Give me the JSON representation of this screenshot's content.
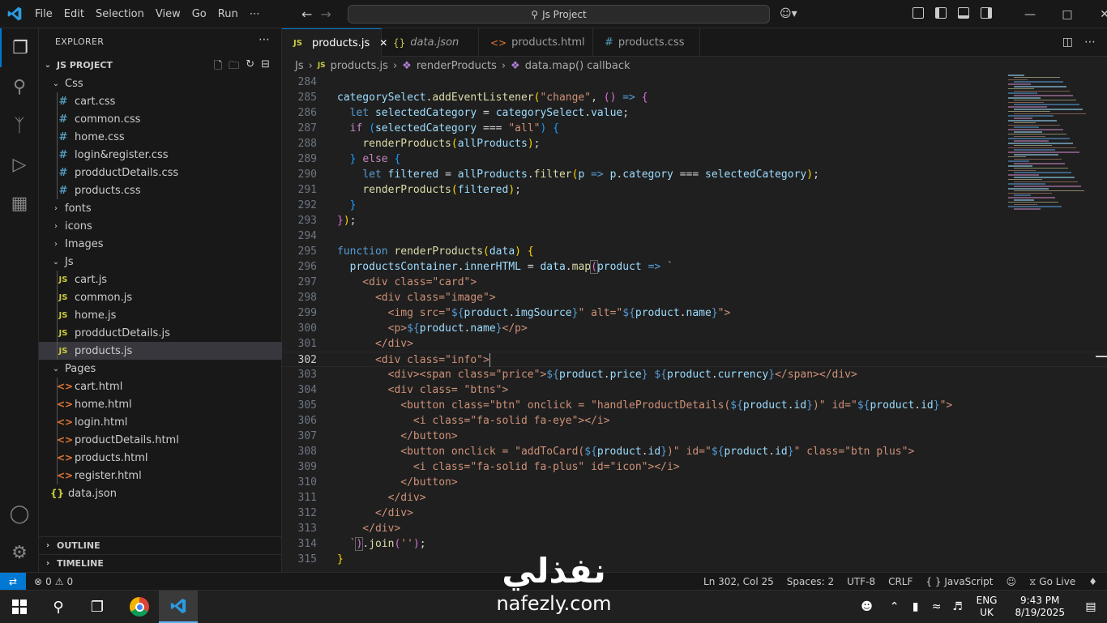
{
  "titlebar": {
    "menu": [
      "File",
      "Edit",
      "Selection",
      "View",
      "Go",
      "Run",
      "⋯"
    ],
    "search": "Js Project"
  },
  "activity": [
    "explorer-icon",
    "search-icon",
    "source-control-icon",
    "run-debug-icon",
    "extensions-icon",
    "accounts-icon",
    "manage-gear-icon"
  ],
  "sidebar": {
    "title": "EXPLORER",
    "project": "JS PROJECT",
    "tree": [
      {
        "label": "Css",
        "type": "folder",
        "open": true,
        "depth": 1
      },
      {
        "label": "cart.css",
        "type": "css",
        "depth": 2
      },
      {
        "label": "common.css",
        "type": "css",
        "depth": 2
      },
      {
        "label": "home.css",
        "type": "css",
        "depth": 2
      },
      {
        "label": "login&register.css",
        "type": "css",
        "depth": 2
      },
      {
        "label": "prodductDetails.css",
        "type": "css",
        "depth": 2
      },
      {
        "label": "products.css",
        "type": "css",
        "depth": 2
      },
      {
        "label": "fonts",
        "type": "folder",
        "open": false,
        "depth": 1
      },
      {
        "label": "icons",
        "type": "folder",
        "open": false,
        "depth": 1
      },
      {
        "label": "Images",
        "type": "folder",
        "open": false,
        "depth": 1
      },
      {
        "label": "Js",
        "type": "folder",
        "open": true,
        "depth": 1
      },
      {
        "label": "cart.js",
        "type": "js",
        "depth": 2
      },
      {
        "label": "common.js",
        "type": "js",
        "depth": 2
      },
      {
        "label": "home.js",
        "type": "js",
        "depth": 2
      },
      {
        "label": "prodductDetails.js",
        "type": "js",
        "depth": 2
      },
      {
        "label": "products.js",
        "type": "js",
        "depth": 2,
        "selected": true
      },
      {
        "label": "Pages",
        "type": "folder",
        "open": true,
        "depth": 1
      },
      {
        "label": "cart.html",
        "type": "html",
        "depth": 2
      },
      {
        "label": "home.html",
        "type": "html",
        "depth": 2
      },
      {
        "label": "login.html",
        "type": "html",
        "depth": 2
      },
      {
        "label": "productDetails.html",
        "type": "html",
        "depth": 2
      },
      {
        "label": "products.html",
        "type": "html",
        "depth": 2
      },
      {
        "label": "register.html",
        "type": "html",
        "depth": 2
      },
      {
        "label": "data.json",
        "type": "json",
        "depth": 1
      }
    ],
    "outline": "OUTLINE",
    "timeline": "TIMELINE"
  },
  "tabs": [
    {
      "label": "products.js",
      "icon": "JS",
      "active": true
    },
    {
      "label": "data.json",
      "icon": "{}",
      "italic": true
    },
    {
      "label": "products.html",
      "icon": "<>"
    },
    {
      "label": "products.css",
      "icon": "#"
    }
  ],
  "breadcrumb": [
    "Js",
    "products.js",
    "renderProducts",
    "data.map() callback"
  ],
  "editor": {
    "current_line": "302",
    "line_numbers": [
      "284",
      "285",
      "286",
      "287",
      "288",
      "289",
      "290",
      "291",
      "292",
      "293",
      "294",
      "295",
      "296",
      "297",
      "298",
      "299",
      "300",
      "301",
      "302",
      "303",
      "304",
      "305",
      "306",
      "307",
      "308",
      "309",
      "310",
      "311",
      "312",
      "313",
      "314",
      "315"
    ]
  },
  "status": {
    "errors": "0",
    "warnings": "0",
    "position": "Ln 302, Col 25",
    "spaces": "Spaces: 2",
    "encoding": "UTF-8",
    "eol": "CRLF",
    "language": "JavaScript",
    "golive": "Go Live"
  },
  "taskbar": {
    "lang1": "ENG",
    "lang2": "UK",
    "time": "9:43 PM",
    "date": "8/19/2025"
  },
  "watermark": {
    "arabic": "نفذلي",
    "latin": "nafezly.com"
  },
  "colors": {
    "accent": "#0078d4",
    "keyword": "#569cd6",
    "function": "#dcdcaa",
    "string": "#ce9178",
    "variable": "#9cdcfe"
  }
}
